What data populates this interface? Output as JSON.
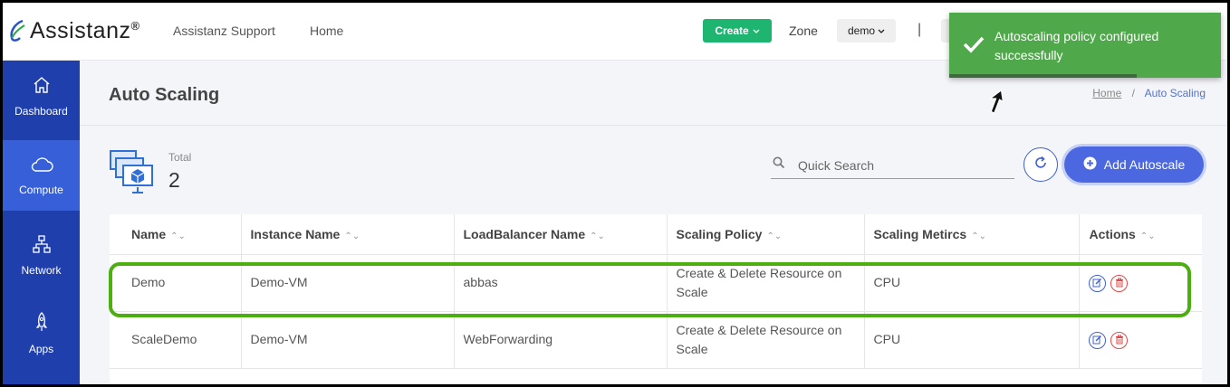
{
  "header": {
    "logo_text": "Assistanz",
    "logo_reg": "®",
    "nav": [
      "Assistanz Support",
      "Home"
    ],
    "create_label": "Create",
    "zone_label": "Zone",
    "zone_value": "demo",
    "separator": "|"
  },
  "sidebar": {
    "items": [
      {
        "label": "Dashboard",
        "icon": "home-icon",
        "active": false
      },
      {
        "label": "Compute",
        "icon": "cloud-icon",
        "active": true
      },
      {
        "label": "Network",
        "icon": "network-icon",
        "active": false
      },
      {
        "label": "Apps",
        "icon": "rocket-icon",
        "active": false
      }
    ]
  },
  "page": {
    "title": "Auto Scaling",
    "breadcrumb": {
      "home": "Home",
      "separator": "/",
      "current": "Auto Scaling"
    }
  },
  "summary": {
    "total_label": "Total",
    "total_count": "2"
  },
  "search": {
    "placeholder": "Quick Search"
  },
  "add_button_label": "Add Autoscale",
  "table": {
    "columns": [
      "Name",
      "Instance Name",
      "LoadBalancer Name",
      "Scaling Policy",
      "Scaling Metircs",
      "Actions"
    ],
    "rows": [
      {
        "name": "Demo",
        "instance": "Demo-VM",
        "loadbalancer": "abbas",
        "policy": "Create & Delete Resource on Scale",
        "metrics": "CPU"
      },
      {
        "name": "ScaleDemo",
        "instance": "Demo-VM",
        "loadbalancer": "WebForwarding",
        "policy": "Create & Delete Resource on Scale",
        "metrics": "CPU"
      }
    ]
  },
  "toast": {
    "message": "Autoscaling policy configured successfully",
    "progress": 0.69
  },
  "colors": {
    "sidebar": "#1f3fad",
    "sidebar_active": "#3760d8",
    "create_button": "#1db56f",
    "primary": "#4c68e0",
    "toast": "#4fa84a",
    "highlight": "#4caf10",
    "delete": "#e04848"
  }
}
